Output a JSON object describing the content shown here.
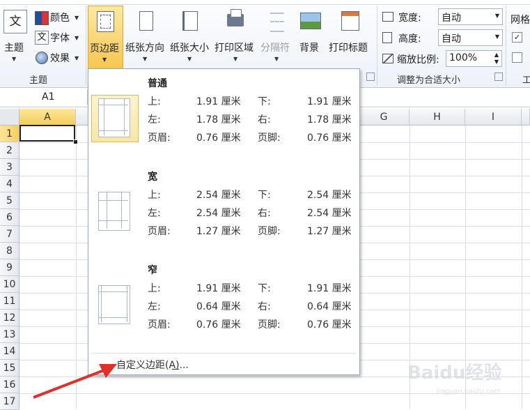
{
  "ribbon": {
    "themes_label": "主题",
    "colors_label": "颜色",
    "fonts_label": "字体",
    "effects_label": "效果",
    "theme_group_label": "主题",
    "margins_label": "页边距",
    "orientation_label": "纸张方向",
    "size_label": "纸张大小",
    "print_area_label": "打印区域",
    "breaks_label": "分隔符",
    "background_label": "背景",
    "print_titles_label": "打印标题",
    "width_label": "宽度:",
    "width_value": "自动",
    "height_label": "高度:",
    "height_value": "自动",
    "scale_label": "缩放比例:",
    "scale_value": "100%",
    "scale_group_label": "调整为合适大小",
    "gridlines_label": "网格",
    "sheet_options_group_label": "工"
  },
  "formula_bar": {
    "name_box": "A1"
  },
  "sheet": {
    "columns": [
      "A",
      "G",
      "H",
      "I"
    ],
    "rows": [
      "1",
      "2",
      "3",
      "4",
      "5",
      "6",
      "7",
      "8",
      "9",
      "10",
      "11",
      "12",
      "13",
      "14",
      "15",
      "16",
      "17"
    ]
  },
  "margins_menu": {
    "presets": [
      {
        "name": "普通",
        "top_label": "上:",
        "top": "1.91 厘米",
        "bottom_label": "下:",
        "bottom": "1.91 厘米",
        "left_label": "左:",
        "left": "1.78 厘米",
        "right_label": "右:",
        "right": "1.78 厘米",
        "header_label": "页眉:",
        "header": "0.76 厘米",
        "footer_label": "页脚:",
        "footer": "0.76 厘米"
      },
      {
        "name": "宽",
        "top_label": "上:",
        "top": "2.54 厘米",
        "bottom_label": "下:",
        "bottom": "2.54 厘米",
        "left_label": "左:",
        "left": "2.54 厘米",
        "right_label": "右:",
        "right": "2.54 厘米",
        "header_label": "页眉:",
        "header": "1.27 厘米",
        "footer_label": "页脚:",
        "footer": "1.27 厘米"
      },
      {
        "name": "窄",
        "top_label": "上:",
        "top": "1.91 厘米",
        "bottom_label": "下:",
        "bottom": "1.91 厘米",
        "left_label": "左:",
        "left": "0.64 厘米",
        "right_label": "右:",
        "right": "0.64 厘米",
        "header_label": "页眉:",
        "header": "0.76 厘米",
        "footer_label": "页脚:",
        "footer": "0.76 厘米"
      }
    ],
    "custom_label": "自定义边距(A)...",
    "custom_underline_char": "A"
  },
  "watermark": {
    "text": "Baidu经验",
    "sub": "jingyan.baidu.com"
  },
  "colors": {
    "accent": "#f7c651",
    "arrow": "#e0302a"
  }
}
